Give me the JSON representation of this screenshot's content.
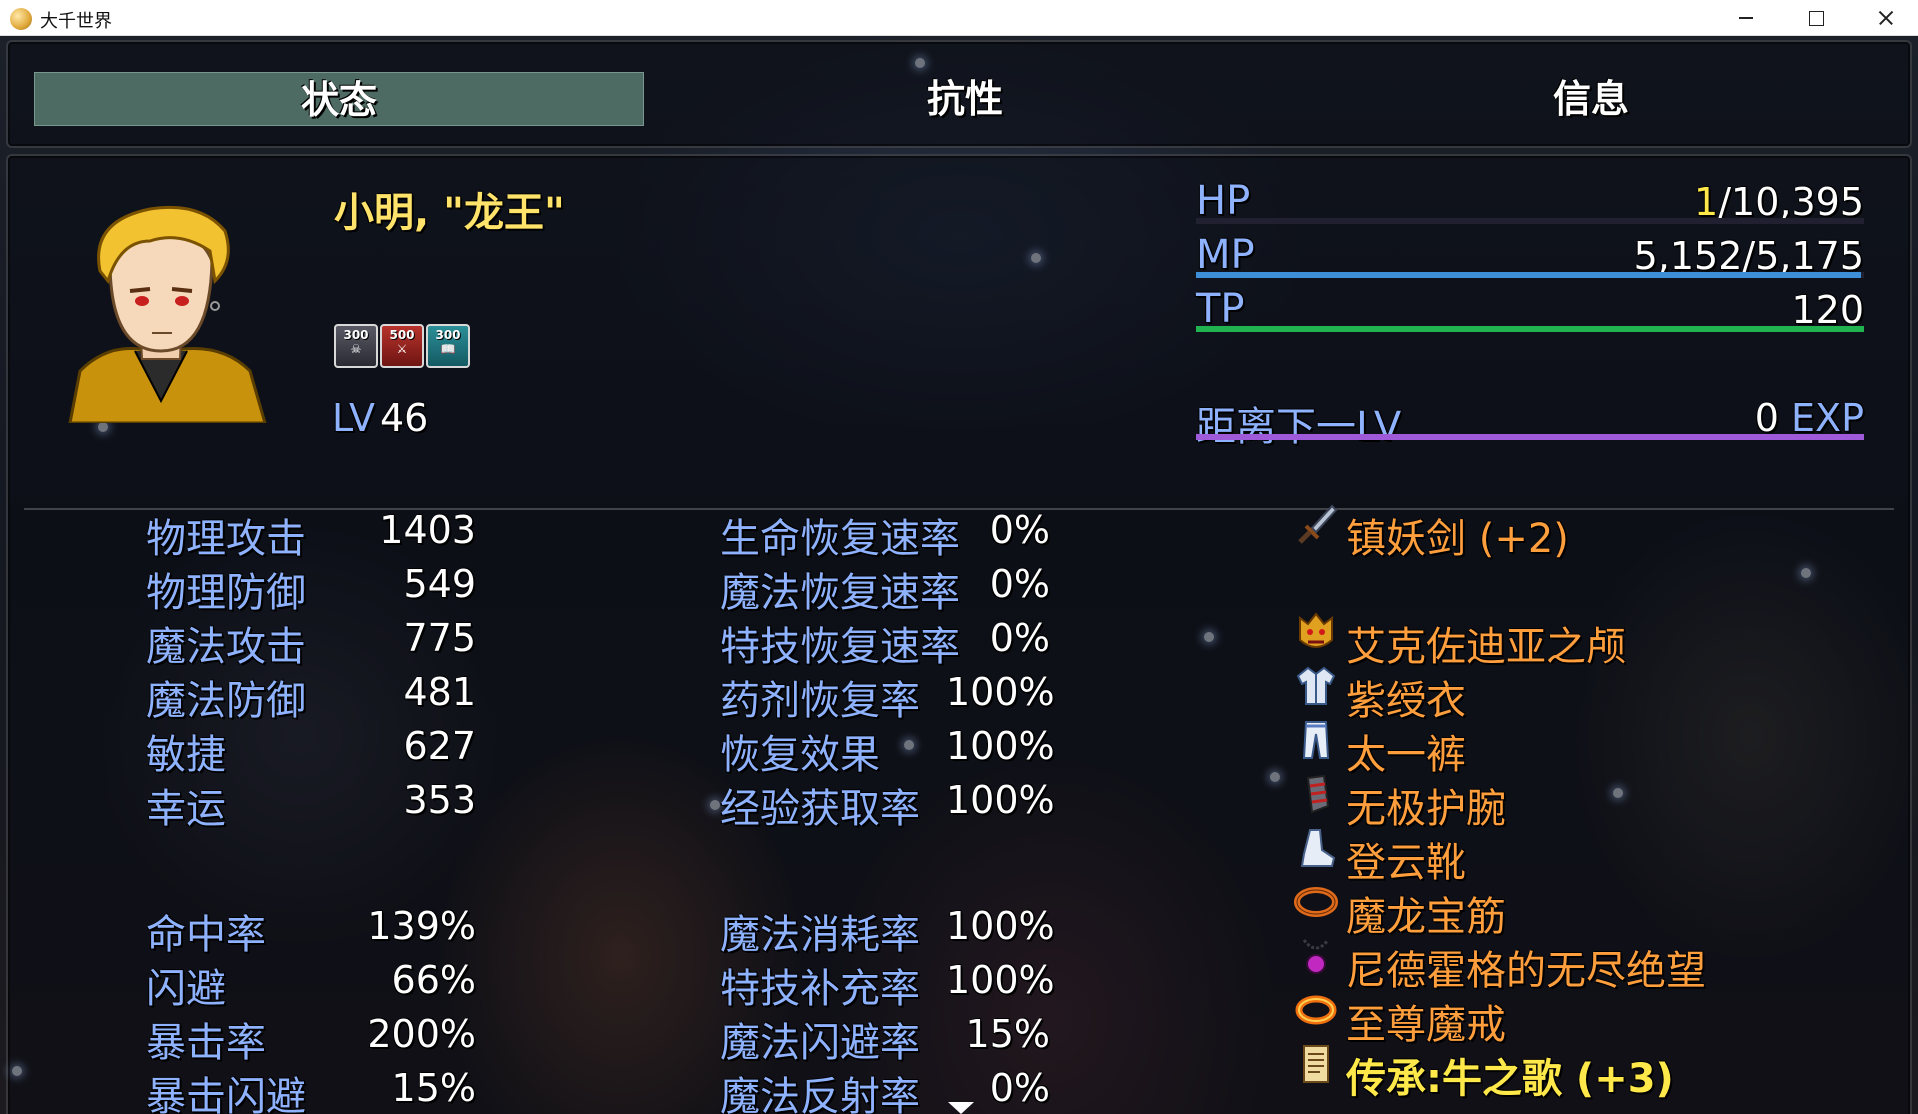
{
  "window": {
    "title": "大千世界"
  },
  "tabs": [
    {
      "label": "状态",
      "active": true
    },
    {
      "label": "抗性",
      "active": false
    },
    {
      "label": "信息",
      "active": false
    }
  ],
  "actor": {
    "name": "小明, \"龙王\"",
    "level_label": "LV",
    "level": "46",
    "states": [
      {
        "turns": "300",
        "icon": "skull-icon"
      },
      {
        "turns": "500",
        "icon": "attack-up-icon"
      },
      {
        "turns": "300",
        "icon": "book-icon"
      }
    ]
  },
  "gauges": {
    "hp": {
      "label": "HP",
      "current": "1",
      "max": "10,395",
      "ratio": 0.0001,
      "color": "#4d5fd1"
    },
    "mp": {
      "label": "MP",
      "value": "5,152/5,175",
      "ratio": 0.996,
      "color": "#3d8fd8"
    },
    "tp": {
      "label": "TP",
      "value": "120",
      "ratio": 1.0,
      "color": "#21b34f"
    },
    "exp": {
      "label": "距离下一LV",
      "value": "0",
      "unit": "EXP",
      "ratio": 1.0,
      "color": "#9e5ad8"
    }
  },
  "params": [
    {
      "label": "物理攻击",
      "value": "1403"
    },
    {
      "label": "物理防御",
      "value": "549"
    },
    {
      "label": "魔法攻击",
      "value": "775"
    },
    {
      "label": "魔法防御",
      "value": "481"
    },
    {
      "label": "敏捷",
      "value": "627"
    },
    {
      "label": "幸运",
      "value": "353"
    }
  ],
  "xparams": [
    {
      "label": "命中率",
      "value": "139%"
    },
    {
      "label": "闪避",
      "value": "66%"
    },
    {
      "label": "暴击率",
      "value": "200%"
    },
    {
      "label": "暴击闪避",
      "value": "15%"
    }
  ],
  "rates": [
    {
      "label": "生命恢复速率",
      "value": "0%"
    },
    {
      "label": "魔法恢复速率",
      "value": "0%"
    },
    {
      "label": "特技恢复速率",
      "value": "0%"
    },
    {
      "label": "药剂恢复率",
      "value": "100%"
    },
    {
      "label": "恢复效果",
      "value": "100%"
    },
    {
      "label": "经验获取率",
      "value": "100%"
    }
  ],
  "rates2": [
    {
      "label": "魔法消耗率",
      "value": "100%"
    },
    {
      "label": "特技补充率",
      "value": "100%"
    },
    {
      "label": "魔法闪避率",
      "value": "15%"
    },
    {
      "label": "魔法反射率",
      "value": "0%"
    }
  ],
  "equips": [
    {
      "name": "镇妖剑 (+2)",
      "icon": "sword-icon",
      "color": "#ff9e3d"
    },
    {
      "name": "",
      "icon": "",
      "color": "#ff9e3d"
    },
    {
      "name": "艾克佐迪亚之颅",
      "icon": "demon-mask-icon",
      "color": "#ff9e3d"
    },
    {
      "name": "紫绶衣",
      "icon": "robe-icon",
      "color": "#ff9e3d"
    },
    {
      "name": "太一裤",
      "icon": "pants-icon",
      "color": "#ff9e3d"
    },
    {
      "name": "无极护腕",
      "icon": "gauntlet-icon",
      "color": "#ff9e3d"
    },
    {
      "name": "登云靴",
      "icon": "boots-icon",
      "color": "#ff9e3d"
    },
    {
      "name": "魔龙宝筋",
      "icon": "belt-icon",
      "color": "#ff9e3d"
    },
    {
      "name": "尼德霍格的无尽绝望",
      "icon": "amulet-icon",
      "color": "#ff9e3d"
    },
    {
      "name": "至尊魔戒",
      "icon": "ring-icon",
      "color": "#ff9e3d"
    },
    {
      "name": "传承:牛之歌 (+3)",
      "icon": "scroll-icon",
      "color": "#ffe84a"
    }
  ]
}
